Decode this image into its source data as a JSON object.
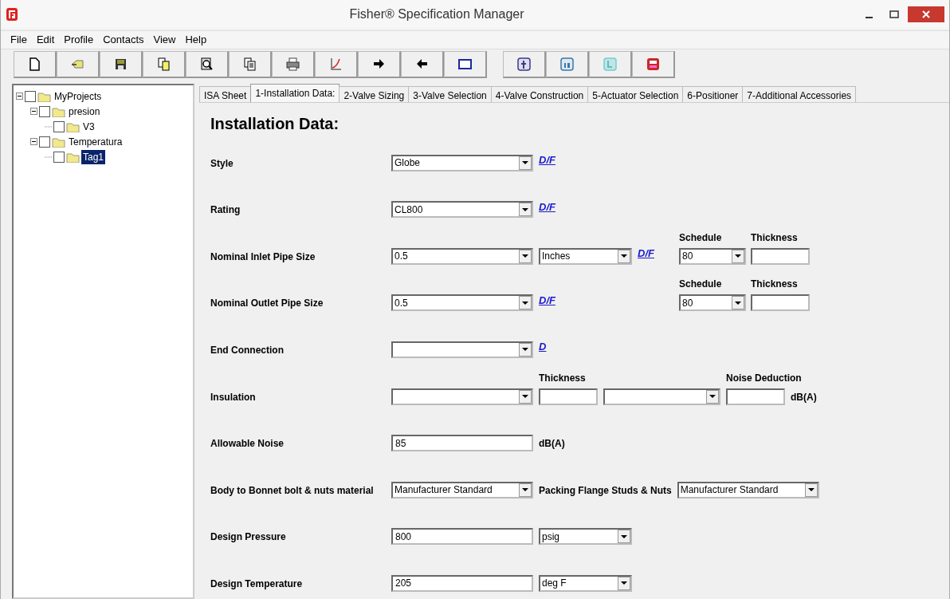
{
  "window": {
    "title": "Fisher® Specification Manager"
  },
  "menu": [
    "File",
    "Edit",
    "Profile",
    "Contacts",
    "View",
    "Help"
  ],
  "toolbar": [
    {
      "kind": "new"
    },
    {
      "kind": "open"
    },
    {
      "kind": "save"
    },
    {
      "kind": "copy"
    },
    {
      "kind": "preview"
    },
    {
      "kind": "document"
    },
    {
      "kind": "print"
    },
    {
      "kind": "chart"
    },
    {
      "kind": "forward"
    },
    {
      "kind": "back"
    },
    {
      "kind": "window"
    }
  ],
  "social": [
    {
      "kind": "f"
    },
    {
      "kind": "in"
    },
    {
      "kind": "bird"
    },
    {
      "kind": "play"
    }
  ],
  "tree": [
    {
      "label": "MyProjects",
      "checked": false,
      "expanded": true,
      "selected": false,
      "children": [
        {
          "label": "presion",
          "checked": false,
          "expanded": true,
          "selected": false,
          "children": [
            {
              "label": "V3",
              "checked": false,
              "selected": false
            }
          ]
        },
        {
          "label": "Temperatura",
          "checked": false,
          "expanded": true,
          "selected": false,
          "children": [
            {
              "label": "Tag1",
              "checked": false,
              "selected": true
            }
          ]
        }
      ]
    }
  ],
  "tabs": [
    {
      "label": "ISA Sheet",
      "selected": false
    },
    {
      "label": "1-Installation Data:",
      "selected": true
    },
    {
      "label": "2-Valve Sizing",
      "selected": false
    },
    {
      "label": "3-Valve Selection",
      "selected": false
    },
    {
      "label": "4-Valve Construction",
      "selected": false
    },
    {
      "label": "5-Actuator Selection",
      "selected": false
    },
    {
      "label": "6-Positioner",
      "selected": false
    },
    {
      "label": "7-Additional Accessories",
      "selected": false
    }
  ],
  "heading": "Installation Data:",
  "rows": [
    {
      "label": "Style",
      "controls": [
        {
          "kind": "combo",
          "value": "Globe"
        },
        {
          "kind": "link",
          "value": "D/F"
        }
      ]
    },
    {
      "label": "Rating",
      "controls": [
        {
          "kind": "combo",
          "value": "CL800"
        },
        {
          "kind": "link",
          "value": "D/F"
        }
      ]
    },
    {
      "label": "Nominal Inlet Pipe Size",
      "controls": [
        {
          "kind": "combo",
          "value": "0.5"
        },
        {
          "kind": "unit-combo",
          "value": "Inches"
        },
        {
          "kind": "link",
          "value": "D/F"
        },
        {
          "kind": "schedule",
          "headers": [
            "Schedule",
            "Thickness"
          ],
          "schedule": "80"
        }
      ]
    },
    {
      "label": "Nominal Outlet Pipe Size",
      "controls": [
        {
          "kind": "combo",
          "value": "0.5"
        },
        {
          "kind": "link",
          "value": "D/F"
        },
        {
          "kind": "schedule",
          "headers": [
            "Schedule",
            "Thickness"
          ],
          "schedule": "80"
        }
      ]
    },
    {
      "label": "End Connection",
      "controls": [
        {
          "kind": "combo"
        },
        {
          "kind": "link",
          "value": "D"
        }
      ]
    },
    {
      "label": "Insulation",
      "controls": [
        {
          "kind": "combo"
        },
        {
          "kind": "short-field",
          "header": "Thickness"
        },
        {
          "kind": "medium-combo"
        },
        {
          "kind": "short-field",
          "header": "Noise Deduction"
        },
        {
          "kind": "unit",
          "value": "dB(A)"
        }
      ]
    },
    {
      "label": "Allowable Noise",
      "controls": [
        {
          "kind": "field",
          "value": "85"
        },
        {
          "kind": "unit",
          "value": "dB(A)"
        }
      ]
    },
    {
      "label": "Body to Bonnet bolt & nuts material",
      "controls": [
        {
          "kind": "combo",
          "value": "Manufacturer Standard"
        },
        {
          "kind": "unit",
          "value": "Packing Flange Studs & Nuts"
        },
        {
          "kind": "combo",
          "value": "Manufacturer Standard"
        }
      ]
    },
    {
      "label": "Design Pressure",
      "controls": [
        {
          "kind": "field",
          "value": "800"
        },
        {
          "kind": "unit-combo",
          "value": "psig"
        }
      ]
    },
    {
      "label": "Design Temperature",
      "controls": [
        {
          "kind": "field",
          "value": "205"
        },
        {
          "kind": "unit-combo",
          "value": "deg F"
        }
      ]
    }
  ]
}
